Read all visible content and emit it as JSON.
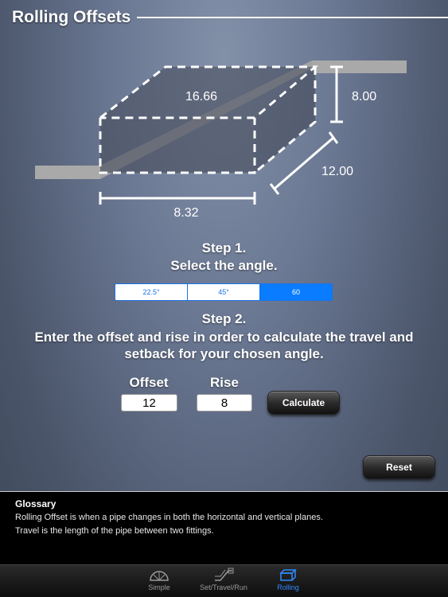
{
  "header": {
    "title": "Rolling Offsets"
  },
  "diagram": {
    "top_dimension": "16.66",
    "height_dimension": "8.00",
    "depth_dimension": "12.00",
    "width_dimension": "8.32"
  },
  "step1": {
    "title": "Step 1.",
    "subtitle": "Select the angle.",
    "angles": [
      "22.5°",
      "45°",
      "60"
    ],
    "selected_angle": "60"
  },
  "step2": {
    "title": "Step 2.",
    "subtitle": "Enter the offset and rise in order to calculate the travel and setback for your chosen angle.",
    "offset_label": "Offset",
    "rise_label": "Rise",
    "offset_value": "12",
    "rise_value": "8",
    "calculate_label": "Calculate"
  },
  "reset_label": "Reset",
  "glossary": {
    "title": "Glossary",
    "line1": "Rolling Offset is when a pipe changes in both the horizontal and vertical planes.",
    "line2": "Travel is the length of the pipe between two fittings."
  },
  "tabbar": {
    "tabs": [
      {
        "label": "Simple",
        "icon": "protractor-icon"
      },
      {
        "label": "Set/Travel/Run",
        "icon": "pipe-offset-icon"
      },
      {
        "label": "Rolling",
        "icon": "box-icon"
      }
    ],
    "active": "Rolling"
  },
  "colors": {
    "accent": "#0a7cff",
    "active_tab": "#2f8cff"
  }
}
